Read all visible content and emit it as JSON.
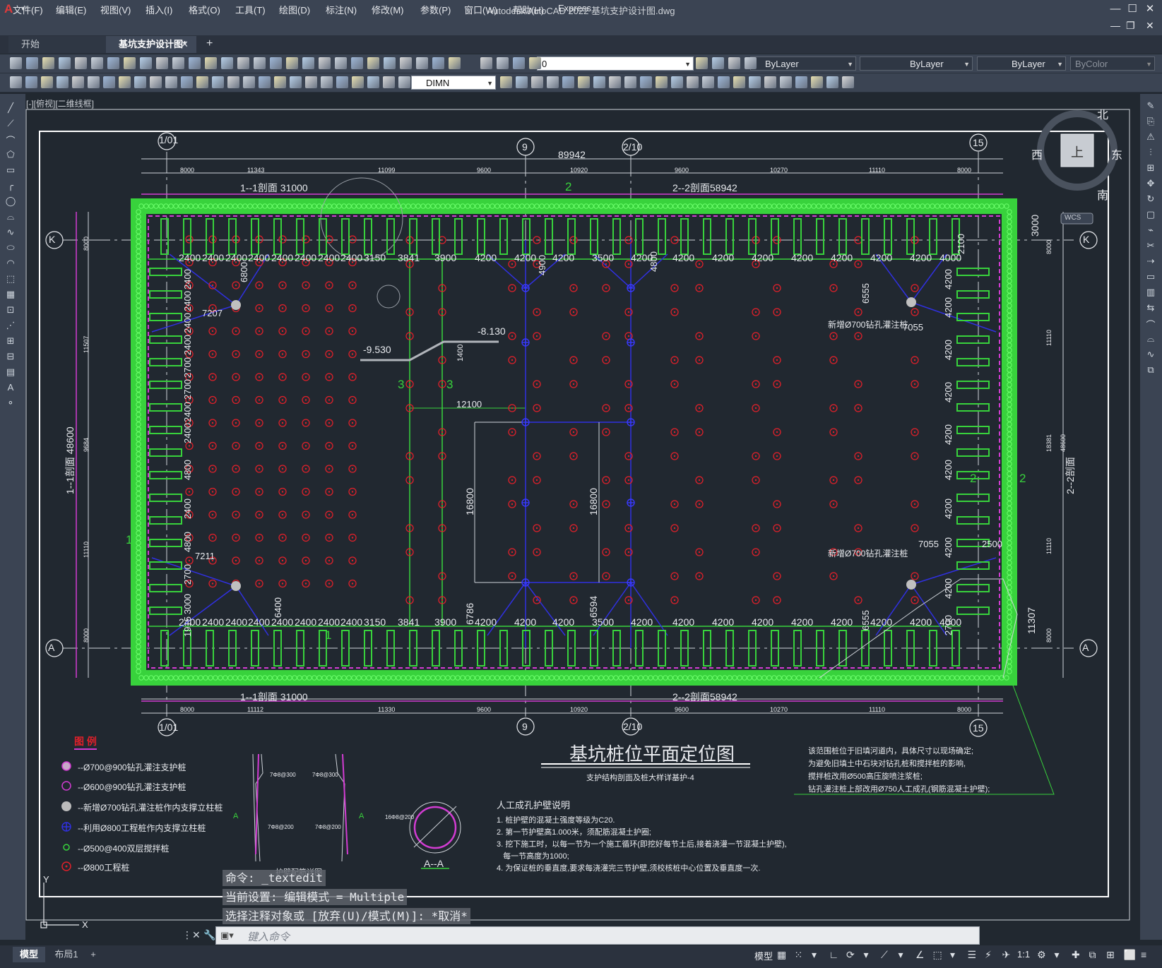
{
  "app": {
    "logo": "A",
    "title": "Autodesk AutoCAD 2022    基坑支护设计图.dwg"
  },
  "window_buttons": [
    "—",
    "☐",
    "✕"
  ],
  "mdi_buttons": [
    "—",
    "❐",
    "✕"
  ],
  "menu": [
    "文件(F)",
    "编辑(E)",
    "视图(V)",
    "插入(I)",
    "格式(O)",
    "工具(T)",
    "绘图(D)",
    "标注(N)",
    "修改(M)",
    "参数(P)",
    "窗口(W)",
    "帮助(H)",
    "Express"
  ],
  "tabs": {
    "start": "开始",
    "document": "基坑支护设计图*",
    "close": "✕",
    "add": "+"
  },
  "toolbar": {
    "layer_value": "0",
    "color_value": "ByLayer",
    "linetype_value": "ByLayer",
    "lineweight_value": "ByLayer",
    "plotstyle_value": "ByColor",
    "dimstyle_value": "DIMN"
  },
  "viewport_label": "[-][俯视][二维线框]",
  "viewcube": {
    "north": "北",
    "south": "南",
    "east": "东",
    "west": "西",
    "face": "上",
    "wcs": "WCS"
  },
  "drawing": {
    "grid_labels": {
      "top": [
        "1/01",
        "9",
        "2/10",
        "15"
      ],
      "bottom": [
        "1/01",
        "9",
        "2/10",
        "15"
      ],
      "side": [
        "K",
        "A"
      ]
    },
    "total_dim": "89942",
    "dim_top_row": [
      "8000",
      "11343",
      "11099",
      "9600",
      "10920",
      "9600",
      "10270",
      "11110",
      "8000"
    ],
    "dim_bottom_row": [
      "8000",
      "11112",
      "11330",
      "9600",
      "10920",
      "9600",
      "10270",
      "11110",
      "8000"
    ],
    "section_11": "1--1剖面  31000",
    "section_22": "2--2剖面58942",
    "pile_spacing_top": [
      "2400",
      "2400",
      "2400",
      "2400",
      "2400",
      "2400",
      "2400",
      "2400",
      "3150",
      "3841",
      "3900",
      "4200",
      "4200",
      "4200",
      "3500",
      "4200",
      "4200",
      "4200",
      "4200",
      "4200",
      "4200",
      "4200",
      "4200",
      "4000"
    ],
    "pile_spacing_bottom": [
      "2400",
      "2400",
      "2400",
      "2400",
      "2400",
      "2400",
      "2400",
      "2400",
      "3150",
      "3841",
      "3900",
      "4200",
      "4200",
      "4200",
      "3500",
      "4200",
      "4200",
      "4200",
      "4200",
      "4200",
      "4200",
      "4200",
      "4200",
      "4000"
    ],
    "left_vertical": [
      "2400",
      "2400",
      "2400",
      "2400",
      "2700",
      "2700",
      "2400",
      "2400",
      "4800",
      "2400",
      "4800",
      "2700",
      "3000",
      "1915"
    ],
    "right_vertical": [
      "4200",
      "4200",
      "4200",
      "4200",
      "4200",
      "4200",
      "4200",
      "4200",
      "4200",
      "2700"
    ],
    "side_dims_left": [
      "1--1剖面  48600",
      "8000",
      "11507",
      "9684",
      "11110",
      "8000"
    ],
    "side_dims_right": [
      "2--2剖面",
      "48600",
      "3000",
      "8000",
      "11110",
      "18381",
      "11110",
      "8000",
      "11307"
    ],
    "misc_dims": [
      "7207",
      "6800",
      "7211",
      "6400",
      "6555",
      "7055",
      "7055",
      "6555",
      "2500",
      "12100",
      "16800",
      "16800",
      "6786",
      "6594",
      "4800",
      "4900",
      "2100",
      "1400",
      "3000"
    ],
    "elevations": [
      "-8.130",
      "-9.530"
    ],
    "section_marks": [
      "1",
      "2",
      "3",
      "3",
      "1",
      "2",
      "2"
    ],
    "new_pile_note_1": "新增Ø700钻孔灌注桩",
    "new_pile_note_2": "新增Ø700钻孔灌注桩",
    "drawing_title": "基坑桩位平面定位图",
    "drawing_subtitle": "支护结构剖面及桩大样详基护-4",
    "legend_title": "图 例",
    "legend": [
      "--Ø700@900钻孔灌注支护桩",
      "--Ø600@900钻孔灌注支护桩",
      "--新增Ø700钻孔灌注桩作内支撑立柱桩",
      "--利用Ø800工程桩作内支撑立柱桩",
      "--Ø500@400双层搅拌桩",
      "--Ø800工程桩"
    ],
    "detail_labels": {
      "pile_hole": "护壁配筋详图",
      "section_aa": "A--A",
      "a_mark": "A",
      "rebar_1": "7Φ8@300",
      "rebar_2": "7Φ8@300",
      "rebar_3": "7Φ8@200",
      "rebar_4": "7Φ8@200",
      "ring_rebar": "16Φ8@200",
      "dim_300": "300",
      "dim_1000": "1000"
    },
    "manual_hole_title": "人工成孔护壁说明",
    "manual_hole_notes": [
      "1. 桩护壁的混凝土强度等级为C20.",
      "2. 第一节护壁高1.000米，须配筋混凝土护圈;",
      "3. 挖下施工时，以每一节为一个施工循环(即挖好每节土后,接着浇灌一节混凝土护壁),",
      "   每一节高度为1000;",
      "4. 为保证桩的垂直度,要求每浇灌完三节护壁,须校核桩中心位置及垂直度一次."
    ],
    "right_notes": [
      "该范围桩位于旧填河道内，具体尺寸以现场确定;",
      "为避免旧填土中石块对钻孔桩和搅拌桩的影响,",
      "搅拌桩改用Ø500高压旋喷注浆桩;",
      "钻孔灌注桩上部改用Ø750人工成孔(钢筋混凝土护壁);"
    ]
  },
  "command": {
    "history": [
      "命令:  _textedit",
      "当前设置: 编辑模式 = Multiple",
      "选择注释对象或 [放弃(U)/模式(M)]: *取消*"
    ],
    "placeholder": "键入命令"
  },
  "layout_tabs": [
    "模型",
    "布局1",
    "+"
  ],
  "status": {
    "model": "模型",
    "scale": "1:1"
  },
  "colors": {
    "pile_green": "#38d23c",
    "pile_red": "#e0202a",
    "brace_blue": "#2c2cd8",
    "magenta": "#d23cd2",
    "background": "#212830"
  }
}
